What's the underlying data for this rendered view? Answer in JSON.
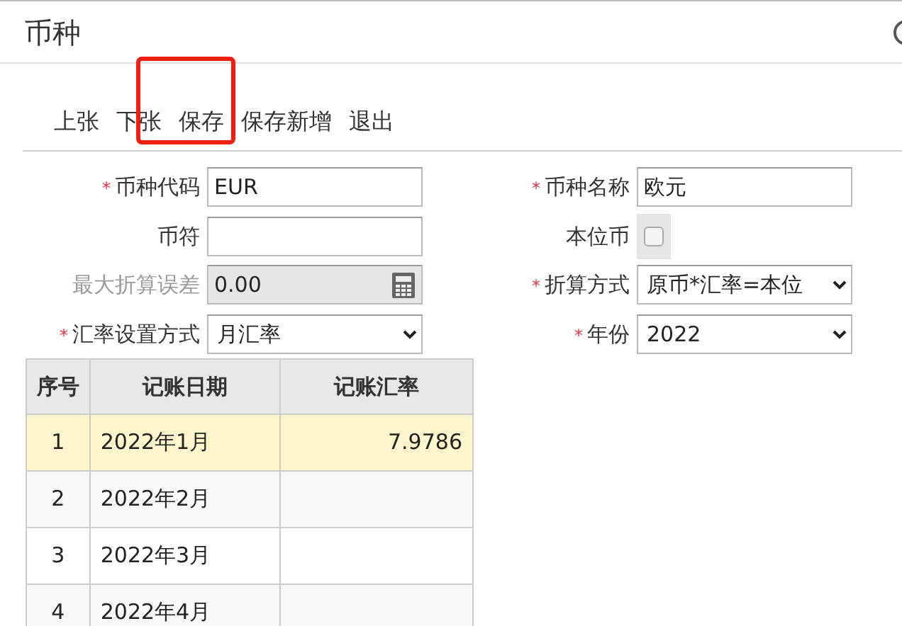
{
  "window": {
    "title": "币种"
  },
  "toolbar": [
    {
      "label": "上张",
      "highlighted": false
    },
    {
      "label": "下张",
      "highlighted": false
    },
    {
      "label": "保存",
      "highlighted": true
    },
    {
      "label": "保存新增",
      "highlighted": false
    },
    {
      "label": "退出",
      "highlighted": false
    }
  ],
  "form": {
    "left": [
      {
        "required_mark": "*",
        "label": "币种代码",
        "kind": "text",
        "value": "EUR",
        "disabled": false
      },
      {
        "label": "币符",
        "kind": "text",
        "disabled": false
      },
      {
        "label": "最大折算误差",
        "kind": "calc",
        "value": "0.00",
        "disabled": true
      },
      {
        "required_mark": "*",
        "label": "汇率设置方式",
        "kind": "select",
        "value": "月汇率",
        "disabled": false
      }
    ],
    "right": [
      {
        "required_mark": "*",
        "label": "币种名称",
        "kind": "text",
        "value": "欧元",
        "disabled": false
      },
      {
        "label": "本位币",
        "kind": "checkbox",
        "checked": false,
        "disabled": true
      },
      {
        "required_mark": "*",
        "label": "折算方式",
        "kind": "select",
        "value": "原币*汇率=本位",
        "disabled": false
      },
      {
        "required_mark": "*",
        "label": "年份",
        "kind": "select",
        "value": "2022",
        "disabled": false
      }
    ]
  },
  "table": {
    "columns": [
      "序号",
      "记账日期",
      "记账汇率"
    ],
    "rows": [
      {
        "cells": [
          "1",
          "2022年1月",
          "7.9786"
        ],
        "selected": true
      },
      {
        "cells": [
          "2",
          "2022年2月",
          ""
        ],
        "selected": false
      },
      {
        "cells": [
          "3",
          "2022年3月",
          ""
        ],
        "selected": false
      },
      {
        "cells": [
          "4",
          "2022年4月",
          ""
        ],
        "selected": false
      }
    ]
  }
}
